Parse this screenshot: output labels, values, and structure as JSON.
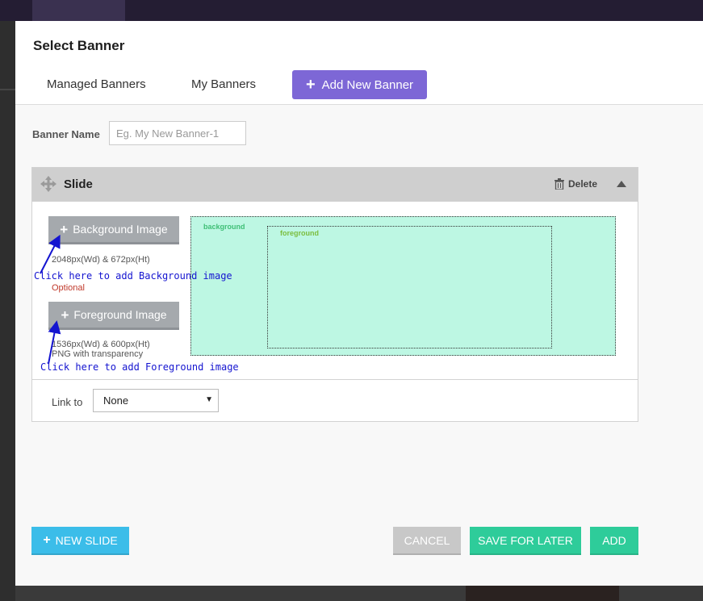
{
  "modal": {
    "title": "Select Banner",
    "tabs": [
      {
        "label": "Managed Banners"
      },
      {
        "label": "My Banners"
      }
    ],
    "add_new_banner_label": "Add New Banner",
    "banner_name": {
      "label": "Banner Name",
      "placeholder": "Eg. My New Banner-1",
      "value": ""
    }
  },
  "slide": {
    "title": "Slide",
    "delete_label": "Delete",
    "background_button": "Background Image",
    "background_hint": "2048px(Wd) & 672px(Ht)",
    "background_optional": "Optional",
    "foreground_button": "Foreground Image",
    "foreground_hint_line1": "1536px(Wd) & 600px(Ht)",
    "foreground_hint_line2": "PNG with transparency",
    "preview_background_label": "background",
    "preview_foreground_label": "foreground",
    "link_label": "Link to",
    "link_selected": "None"
  },
  "annotations": {
    "background": "Click here to add Background image",
    "foreground": "Click here to add Foreground image"
  },
  "footer": {
    "new_slide": "NEW SLIDE",
    "cancel": "CANCEL",
    "save_for_later": "SAVE FOR LATER",
    "add": "ADD"
  },
  "colors": {
    "accent_purple": "#7d67d6",
    "new_slide_blue": "#3bbde9",
    "success_green": "#2ecc9a",
    "preview_fill": "#bdf7e3",
    "annotation_blue": "#1414d0"
  }
}
